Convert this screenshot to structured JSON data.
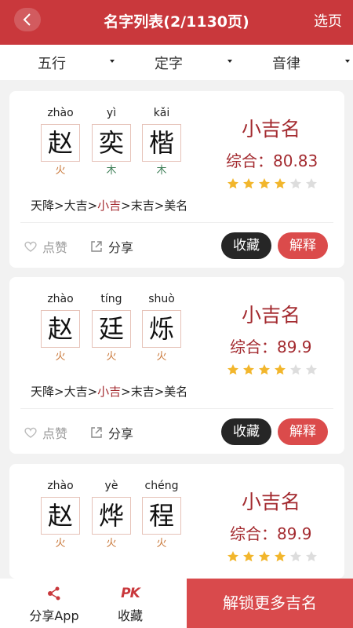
{
  "header": {
    "title": "名字列表(2/1130页)",
    "action": "选页"
  },
  "filters": [
    {
      "label": "五行"
    },
    {
      "label": "定字"
    },
    {
      "label": "音律"
    }
  ],
  "cards": [
    {
      "chars": [
        {
          "pinyin": "zhào",
          "hanzi": "赵",
          "element": "火",
          "element_color": "#c9783a"
        },
        {
          "pinyin": "yì",
          "hanzi": "奕",
          "element": "木",
          "element_color": "#3f7f58"
        },
        {
          "pinyin": "kǎi",
          "hanzi": "楷",
          "element": "木",
          "element_color": "#3f7f58"
        }
      ],
      "grade": "小吉名",
      "score": "综合：80.83",
      "stars": 4,
      "star_total": 6,
      "chain": {
        "pre": "天降>大吉>",
        "hl": "小吉",
        "post": ">末吉>美名"
      },
      "like": "点赞",
      "share": "分享",
      "fav": "收藏",
      "explain": "解释"
    },
    {
      "chars": [
        {
          "pinyin": "zhào",
          "hanzi": "赵",
          "element": "火",
          "element_color": "#c9783a"
        },
        {
          "pinyin": "tíng",
          "hanzi": "廷",
          "element": "火",
          "element_color": "#c9783a"
        },
        {
          "pinyin": "shuò",
          "hanzi": "烁",
          "element": "火",
          "element_color": "#c9783a"
        }
      ],
      "grade": "小吉名",
      "score": "综合：89.9",
      "stars": 4,
      "star_total": 6,
      "chain": {
        "pre": "天降>大吉>",
        "hl": "小吉",
        "post": ">末吉>美名"
      },
      "like": "点赞",
      "share": "分享",
      "fav": "收藏",
      "explain": "解释"
    },
    {
      "chars": [
        {
          "pinyin": "zhào",
          "hanzi": "赵",
          "element": "火",
          "element_color": "#c9783a"
        },
        {
          "pinyin": "yè",
          "hanzi": "烨",
          "element": "火",
          "element_color": "#c9783a"
        },
        {
          "pinyin": "chéng",
          "hanzi": "程",
          "element": "火",
          "element_color": "#c9783a"
        }
      ],
      "grade": "小吉名",
      "score": "综合：89.9",
      "stars": 4,
      "star_total": 6
    }
  ],
  "bottom": {
    "share_app": "分享App",
    "pk_icon": "PK",
    "favorites": "收藏",
    "unlock": "解锁更多吉名"
  },
  "colors": {
    "brand": "#c9383c",
    "grade": "#a32a2f",
    "star_on": "#f2b62c",
    "star_off": "#dddddd"
  }
}
